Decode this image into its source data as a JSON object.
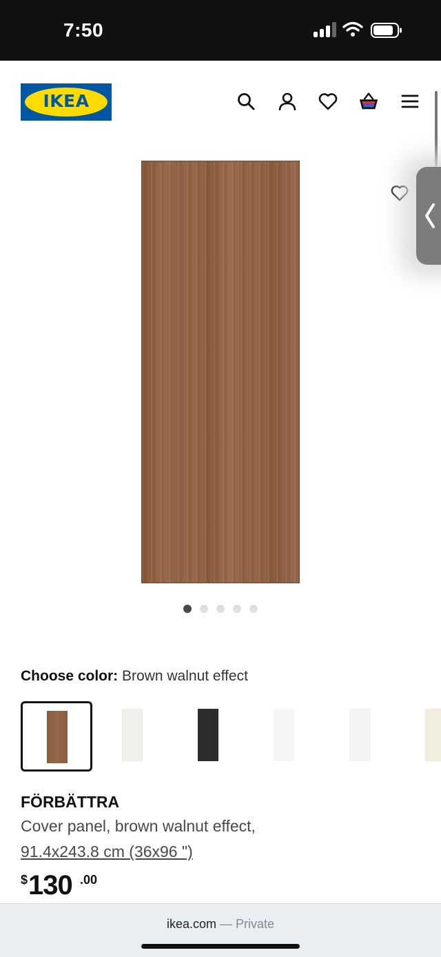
{
  "status_bar": {
    "time": "7:50"
  },
  "header": {
    "logo_text": "IKEA",
    "icons": [
      "search-icon",
      "profile-icon",
      "wishlist-heart-icon",
      "cart-basket-icon",
      "menu-hamburger-icon"
    ]
  },
  "gallery": {
    "image_count": 5,
    "active_index": 0,
    "favorite_icon": "heart-outline-icon",
    "side_tab_icon": "chevron-left-icon"
  },
  "color_picker": {
    "label": "Choose color:",
    "selected_value": "Brown walnut effect",
    "swatches": [
      {
        "color": "#8c5e40",
        "selected": true
      },
      {
        "color": "#f3f1ec",
        "selected": false
      },
      {
        "color": "#2f2f2f",
        "selected": false
      },
      {
        "color": "#f6f6f6",
        "selected": false
      },
      {
        "color": "#f5f5f5",
        "selected": false
      },
      {
        "color": "#f3efe1",
        "selected": false
      }
    ]
  },
  "product": {
    "name": "FÖRBÄTTRA",
    "description": "Cover panel, brown walnut effect,",
    "size": "91.4x243.8 cm (36x96 \")",
    "price_currency": "$",
    "price_integer": "130",
    "price_decimal": ".00"
  },
  "browser": {
    "domain": "ikea.com",
    "separator": " — ",
    "mode": "Private"
  },
  "colors": {
    "ikea_blue": "#0058a3",
    "ikea_yellow": "#ffdb00",
    "wood": "#8c5e40"
  }
}
